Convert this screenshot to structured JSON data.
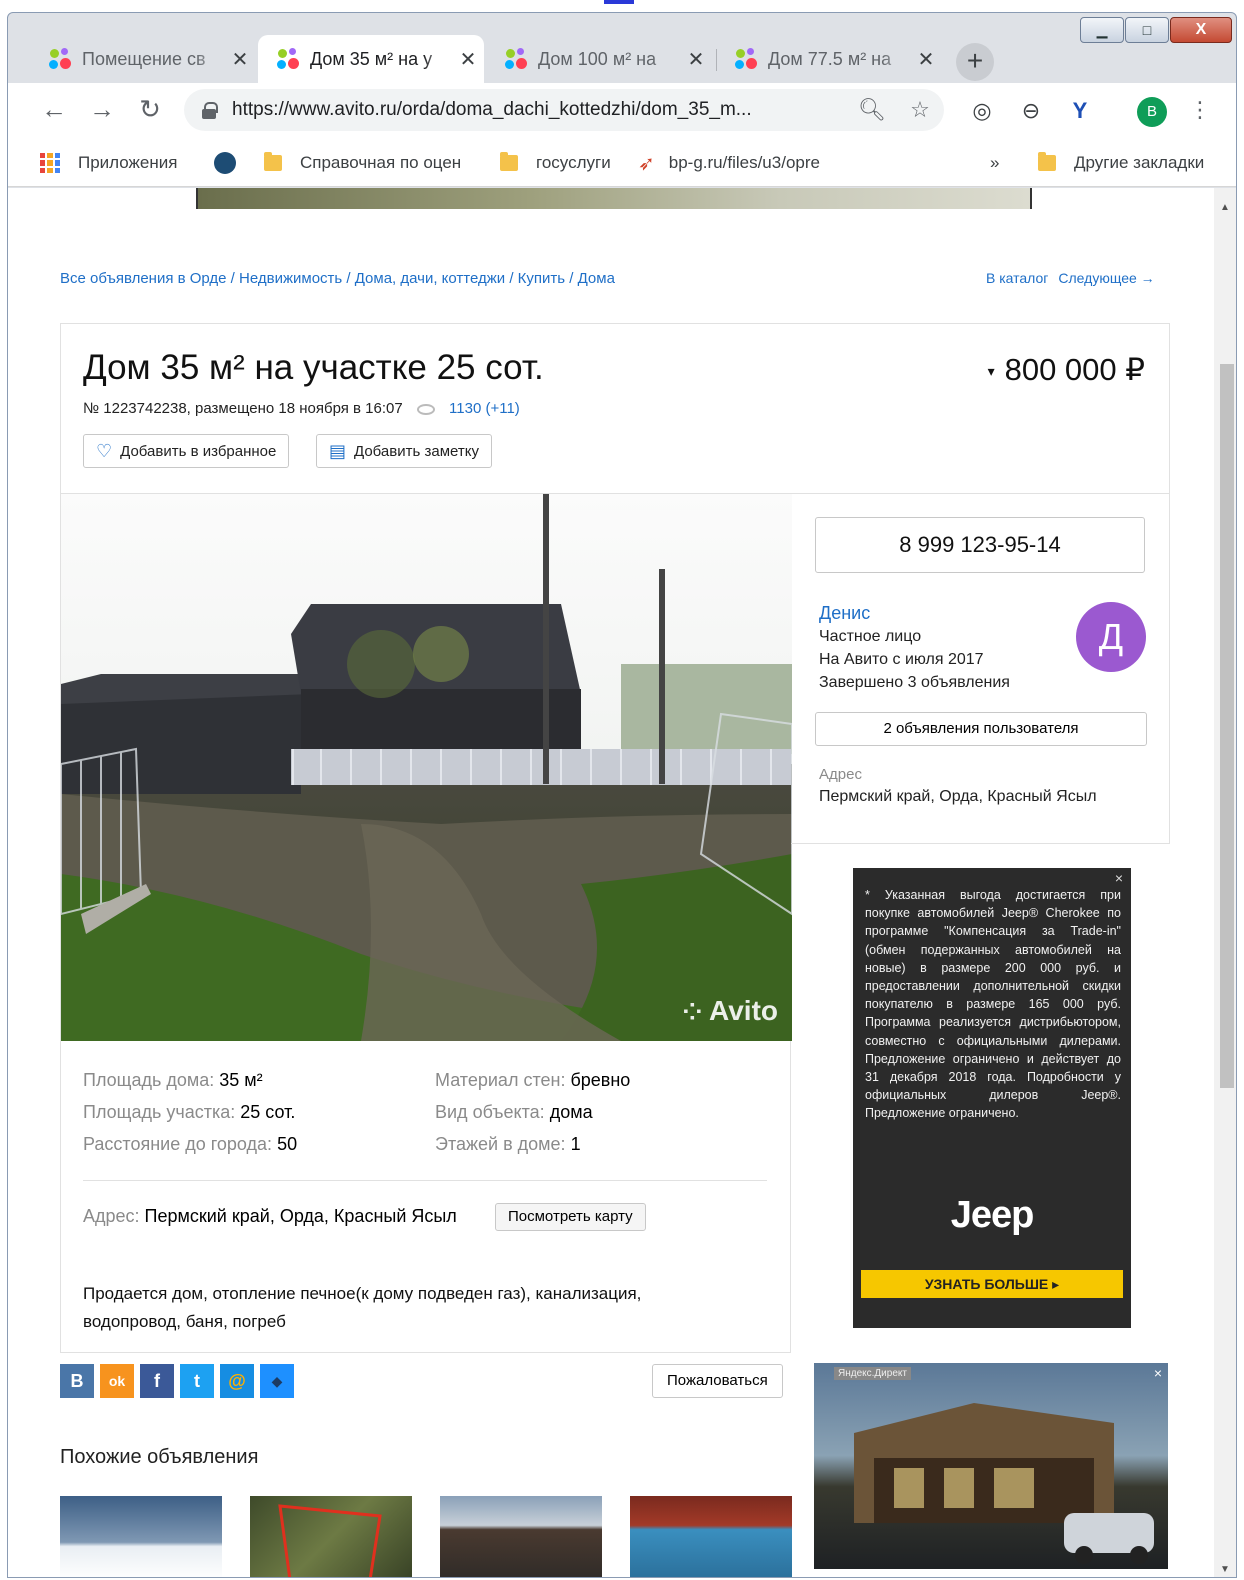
{
  "browser": {
    "tabs": [
      {
        "label": "Помещение св",
        "active": false
      },
      {
        "label": "Дом 35 м² на у",
        "active": true
      },
      {
        "label": "Дом 100 м² на",
        "active": false
      },
      {
        "label": "Дом 77.5 м² на",
        "active": false
      }
    ],
    "url": "https://www.avito.ru/orda/doma_dachi_kottedzhi/dom_35_m...",
    "profile_letter": "B",
    "bookmarks": {
      "apps": "Приложения",
      "b1": "Справочная по оцен",
      "b2": "госуслуги",
      "b3": "bp-g.ru/files/u3/opre",
      "more": "»",
      "other": "Другие закладки"
    }
  },
  "breadcrumbs": "Все объявления в Орде / Недвижимость / Дома, дачи, коттеджи / Купить / Дома",
  "top_links": {
    "catalog": "В каталог",
    "next": "Следующее →"
  },
  "listing": {
    "title": "Дом 35 м² на участке 25 сот.",
    "meta": "№ 1223742238, размещено 18 ноября в 16:07",
    "views": "1130 (+11)",
    "price": "800 000 ₽",
    "fav_button": "Добавить в избранное",
    "note_button": "Добавить заметку",
    "watermark": "Avito",
    "params_left": [
      {
        "key": "Площадь дома: ",
        "value": "35 м²"
      },
      {
        "key": "Площадь участка: ",
        "value": "25 сот."
      },
      {
        "key": "Расстояние до города: ",
        "value": "50"
      }
    ],
    "params_right": [
      {
        "key": "Материал стен: ",
        "value": "бревно"
      },
      {
        "key": "Вид объекта: ",
        "value": "дома"
      },
      {
        "key": "Этажей в доме: ",
        "value": "1"
      }
    ],
    "address_key": "Адрес: ",
    "address_value": "Пермский край, Орда, Красный Ясыл",
    "map_button": "Посмотреть карту",
    "description": "Продается дом, отопление печное(к дому подведен газ), канализация, водопровод, баня, погреб"
  },
  "seller": {
    "phone": "8 999 123-95-14",
    "name": "Денис",
    "type": "Частное лицо",
    "since": "На Авито с июля 2017",
    "completed": "Завершено 3 объявления",
    "avatar_letter": "Д",
    "user_ads_button": "2 объявления пользователя",
    "address_label": "Адрес",
    "address": "Пермский край, Орда, Красный Ясыл"
  },
  "ad": {
    "close": "×",
    "fine_print": "* Указанная выгода достигается при покупке автомобилей Jeep® Cherokee по программе \"Компенсация за Trade-in\" (обмен подержанных автомобилей на новые) в размере 200 000 руб. и предоставлении дополнительной скидки покупателю в размере 165 000 руб. Программа реализуется дистрибьютором, совместно с официальными дилерами. Предложение ограничено и действует до 31 декабря 2018 года. Подробности у официальных дилеров Jeep®. Предложение ограничено.",
    "brand": "Jeep",
    "cta": "УЗНАТЬ БОЛЬШЕ ▸"
  },
  "ad2": {
    "tag": "Яндекс.Директ",
    "close": "×"
  },
  "social": [
    "В",
    "ok",
    "f",
    "t",
    "@",
    "◆"
  ],
  "report_button": "Пожаловаться",
  "similar_heading": "Похожие объявления",
  "colors": {
    "link": "#1f6fc7",
    "avatar": "#9b59d0",
    "cta": "#f6c700"
  }
}
